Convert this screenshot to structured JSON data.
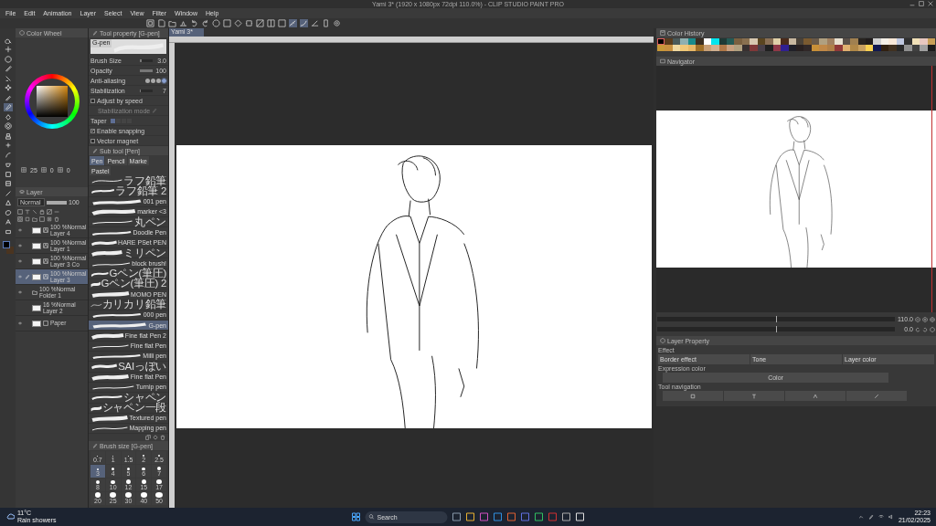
{
  "window": {
    "title": "Yami 3* (1920 x 1080px 72dpi 110.0%) - CLIP STUDIO PAINT PRO"
  },
  "menu": [
    "File",
    "Edit",
    "Animation",
    "Layer",
    "Select",
    "View",
    "Filter",
    "Window",
    "Help"
  ],
  "toolbox": {
    "tools": [
      {
        "selected": false
      },
      {
        "selected": false
      },
      {
        "selected": false
      },
      {
        "selected": false
      },
      {
        "selected": false
      },
      {
        "selected": false
      },
      {
        "selected": false
      },
      {
        "selected": true
      },
      {
        "selected": false
      },
      {
        "selected": false
      },
      {
        "selected": false
      },
      {
        "selected": false
      },
      {
        "selected": false
      },
      {
        "selected": false
      },
      {
        "selected": false
      },
      {
        "selected": false
      },
      {
        "selected": false
      },
      {
        "selected": false
      },
      {
        "selected": false
      },
      {
        "selected": false
      },
      {
        "selected": false
      }
    ]
  },
  "color_wheel": {
    "title": "Color Wheel",
    "stats": [
      "25",
      "0",
      "0"
    ]
  },
  "tool_property": {
    "title": "Tool property [G-pen]",
    "preview_label": "G-pen",
    "rows": [
      {
        "kind": "slider",
        "label": "Brush Size",
        "value": "3.0",
        "level": 0.12
      },
      {
        "kind": "slider",
        "label": "Opacity",
        "value": "100",
        "level": 1
      },
      {
        "kind": "choice",
        "label": "Anti-aliasing",
        "options": [
          {
            "selected": false
          },
          {
            "selected": false
          },
          {
            "selected": false
          },
          {
            "selected": true
          }
        ]
      },
      {
        "kind": "slider",
        "label": "Stabilization",
        "value": "7",
        "level": 0.1
      },
      {
        "kind": "check",
        "label": "Adjust by speed",
        "checked": false
      },
      {
        "kind": "mode",
        "label": "Stabilization mode"
      },
      {
        "kind": "taper",
        "label": "Taper",
        "segments": [
          {
            "selected": true
          },
          {
            "selected": false
          },
          {
            "selected": false
          },
          {
            "selected": false
          }
        ]
      },
      {
        "kind": "check",
        "label": "Enable snapping",
        "checked": true
      },
      {
        "kind": "check",
        "label": "Vector magnet",
        "checked": false
      }
    ]
  },
  "layer_panel": {
    "title": "Layer",
    "blend_mode": "Normal",
    "opacity": "100",
    "opacity_slider": {
      "level": 1
    },
    "layers": [
      {
        "kind": "vector",
        "mode": "100 %Normal",
        "name": "Layer 4",
        "visible": true,
        "selected": false
      },
      {
        "kind": "vector",
        "mode": "100 %Normal",
        "name": "Layer 1",
        "visible": true,
        "selected": false
      },
      {
        "kind": "vector",
        "mode": "100 %Normal",
        "name": "Layer 3 Co",
        "visible": true,
        "selected": false
      },
      {
        "kind": "vector",
        "mode": "100 %Normal",
        "name": "Layer 3",
        "visible": true,
        "selected": true
      },
      {
        "kind": "folder",
        "mode": "100 %Normal",
        "name": "Folder 1",
        "visible": true,
        "selected": false
      },
      {
        "kind": "raster",
        "mode": "16 %Normal",
        "name": "Layer 2",
        "visible": false,
        "selected": false
      },
      {
        "kind": "paper",
        "name": "Paper",
        "visible": true,
        "selected": false
      }
    ]
  },
  "sub_tool": {
    "title": "Sub tool [Pen]",
    "tabs": [
      {
        "label": "Pen",
        "selected": true
      },
      {
        "label": "Pencil",
        "selected": false
      },
      {
        "label": "Marke",
        "selected": false
      },
      {
        "label": "Pastel",
        "selected": false
      }
    ],
    "brushes": [
      {
        "name": "ラフ鉛筆",
        "selected": false
      },
      {
        "name": "ラフ鉛筆 2",
        "selected": false
      },
      {
        "name": "001 pen",
        "selected": false
      },
      {
        "name": "marker <3",
        "selected": false
      },
      {
        "name": "丸ペン",
        "selected": false
      },
      {
        "name": "Doodle Pen",
        "selected": false
      },
      {
        "name": "HARE PSet PEN",
        "selected": false
      },
      {
        "name": "ミリペン",
        "selected": false
      },
      {
        "name": "block brush!",
        "selected": false
      },
      {
        "name": "Gペン(筆圧)",
        "selected": false
      },
      {
        "name": "Gペン(筆圧) 2",
        "selected": false
      },
      {
        "name": "MOMO PEN",
        "selected": false
      },
      {
        "name": "カリカリ鉛筆",
        "selected": false
      },
      {
        "name": "000 pen",
        "selected": false
      },
      {
        "name": "G-pen",
        "selected": true
      },
      {
        "name": "Fine flat Pen 2",
        "selected": false
      },
      {
        "name": "Fine flat Pen",
        "selected": false
      },
      {
        "name": "Milli pen",
        "selected": false
      },
      {
        "name": "SAIっぽい",
        "selected": false
      },
      {
        "name": "Fine flat Pen",
        "selected": false
      },
      {
        "name": "Turnip pen",
        "selected": false
      },
      {
        "name": "シャペン",
        "selected": false
      },
      {
        "name": "シャペン一段",
        "selected": false
      },
      {
        "name": "Textured pen",
        "selected": false
      },
      {
        "name": "Mapping pen",
        "selected": false
      }
    ]
  },
  "brush_size": {
    "title": "Brush size [G-pen]",
    "sizes": [
      {
        "label": "0.7",
        "selected": false
      },
      {
        "label": "1",
        "selected": false
      },
      {
        "label": "1.5",
        "selected": false
      },
      {
        "label": "2",
        "selected": false
      },
      {
        "label": "2.5",
        "selected": false
      },
      {
        "label": "3",
        "selected": true
      },
      {
        "label": "4",
        "selected": false
      },
      {
        "label": "5",
        "selected": false
      },
      {
        "label": "6",
        "selected": false
      },
      {
        "label": "7",
        "selected": false
      },
      {
        "label": "8",
        "selected": false
      },
      {
        "label": "10",
        "selected": false
      },
      {
        "label": "12",
        "selected": false
      },
      {
        "label": "15",
        "selected": false
      },
      {
        "label": "17",
        "selected": false
      },
      {
        "label": "20",
        "selected": false
      },
      {
        "label": "25",
        "selected": false
      },
      {
        "label": "30",
        "selected": false
      },
      {
        "label": "40",
        "selected": false
      },
      {
        "label": "50",
        "selected": false
      }
    ]
  },
  "canvas": {
    "tab": "Yami 3*"
  },
  "color_history": {
    "title": "Color History",
    "swatches": [
      {
        "color": "#000000",
        "selected": true
      },
      {
        "color": "#5a3d1e",
        "selected": false
      },
      {
        "color": "#4a5a5a",
        "selected": false
      },
      {
        "color": "#8fb0b0",
        "selected": false
      },
      {
        "color": "#1a8a8a",
        "selected": false
      },
      {
        "color": "#3a2e22",
        "selected": false
      },
      {
        "color": "#ffffff",
        "selected": false
      },
      {
        "color": "#00e5ee",
        "selected": false
      },
      {
        "color": "#1e3a36",
        "selected": false
      },
      {
        "color": "#245a55",
        "selected": false
      },
      {
        "color": "#7a6040",
        "selected": false
      },
      {
        "color": "#8a7050",
        "selected": false
      },
      {
        "color": "#d8c8b0",
        "selected": false
      },
      {
        "color": "#5a4520",
        "selected": false
      },
      {
        "color": "#8a7055",
        "selected": false
      },
      {
        "color": "#e0d0a8",
        "selected": false
      },
      {
        "color": "#4a2a1a",
        "selected": false
      },
      {
        "color": "#c8b8a0",
        "selected": false
      },
      {
        "color": "#4a4238",
        "selected": false
      },
      {
        "color": "#7a5a30",
        "selected": false
      },
      {
        "color": "#6a5a48",
        "selected": false
      },
      {
        "color": "#b0a080",
        "selected": false
      },
      {
        "color": "#a08060",
        "selected": false
      },
      {
        "color": "#e8e0d0",
        "selected": false
      },
      {
        "color": "#5a5048",
        "selected": false
      },
      {
        "color": "#a08050",
        "selected": false
      },
      {
        "color": "#282420",
        "selected": false
      },
      {
        "color": "#201c1c",
        "selected": false
      },
      {
        "color": "#d0d0d0",
        "selected": false
      },
      {
        "color": "#f5f0e8",
        "selected": false
      },
      {
        "color": "#f8e8d8",
        "selected": false
      },
      {
        "color": "#c0c8e0",
        "selected": false
      },
      {
        "color": "#303030",
        "selected": false
      },
      {
        "color": "#f0e0b8",
        "selected": false
      },
      {
        "color": "#e8c8c0",
        "selected": false
      },
      {
        "color": "#c8a058",
        "selected": false
      },
      {
        "color": "#c89838",
        "selected": false
      },
      {
        "color": "#c89040",
        "selected": false
      },
      {
        "color": "#f0d8a0",
        "selected": false
      },
      {
        "color": "#f0c878",
        "selected": false
      },
      {
        "color": "#e8b868",
        "selected": false
      },
      {
        "color": "#a07028",
        "selected": false
      },
      {
        "color": "#c8a078",
        "selected": false
      },
      {
        "color": "#d0b090",
        "selected": false
      },
      {
        "color": "#b07848",
        "selected": false
      },
      {
        "color": "#c8a080",
        "selected": false
      },
      {
        "color": "#b0a080",
        "selected": false
      },
      {
        "color": "#383030",
        "selected": false
      },
      {
        "color": "#803838",
        "selected": false
      },
      {
        "color": "#484048",
        "selected": false
      },
      {
        "color": "#202020",
        "selected": false
      },
      {
        "color": "#903848",
        "selected": false
      },
      {
        "color": "#302090",
        "selected": false
      },
      {
        "color": "#202028",
        "selected": false
      },
      {
        "color": "#282020",
        "selected": false
      },
      {
        "color": "#302828",
        "selected": false
      },
      {
        "color": "#c89038",
        "selected": false
      },
      {
        "color": "#c08848",
        "selected": false
      },
      {
        "color": "#b08048",
        "selected": false
      },
      {
        "color": "#903838",
        "selected": false
      },
      {
        "color": "#e0b070",
        "selected": false
      },
      {
        "color": "#b08848",
        "selected": false
      },
      {
        "color": "#c8a060",
        "selected": false
      },
      {
        "color": "#f8d050",
        "selected": false
      },
      {
        "color": "#101850",
        "selected": false
      },
      {
        "color": "#302010",
        "selected": false
      },
      {
        "color": "#403020",
        "selected": false
      },
      {
        "color": "#282828",
        "selected": false
      },
      {
        "color": "#909090",
        "selected": false
      },
      {
        "color": "#404040",
        "selected": false
      },
      {
        "color": "#a0a0a0",
        "selected": false
      },
      {
        "color": "#1c1c1c",
        "selected": false
      }
    ]
  },
  "navigator": {
    "title": "Navigator",
    "zoom": "110.0",
    "zoom_slider": {
      "level": 0.5
    },
    "rotation": "0.0",
    "rotation_slider": {
      "level": 0.5
    }
  },
  "layer_property": {
    "title": "Layer Property",
    "effect_label": "Effect",
    "effects": [
      "Border effect",
      "Tone",
      "Layer color"
    ],
    "expression_label": "Expression color",
    "expression_value": "Color",
    "tool_navigation_label": "Tool navigation"
  },
  "taskbar": {
    "temperature": "11°C",
    "weather": "Rain showers",
    "search_placeholder": "Search",
    "time": "22:23",
    "date": "21/02/2025"
  }
}
